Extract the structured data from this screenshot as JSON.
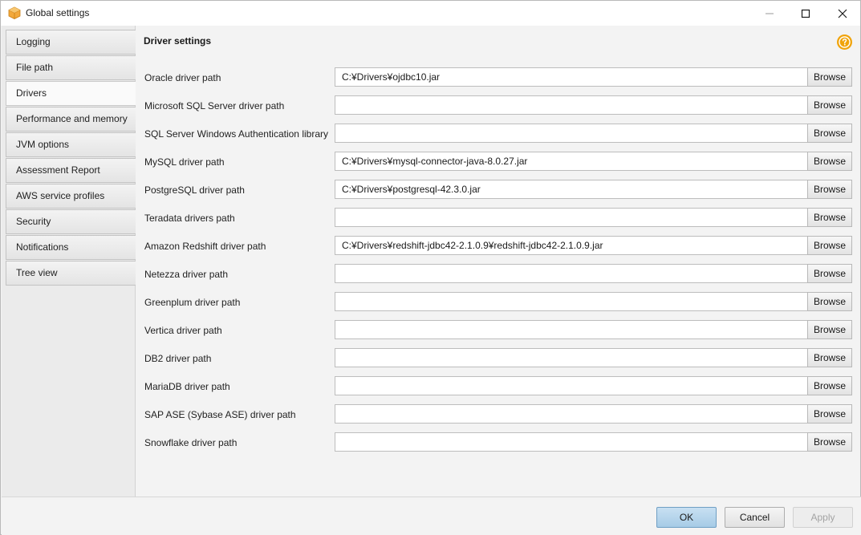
{
  "window": {
    "title": "Global settings"
  },
  "sidebar": {
    "items": [
      {
        "label": "Logging",
        "active": false
      },
      {
        "label": "File path",
        "active": false
      },
      {
        "label": "Drivers",
        "active": true
      },
      {
        "label": "Performance and memory",
        "active": false
      },
      {
        "label": "JVM options",
        "active": false
      },
      {
        "label": "Assessment Report",
        "active": false
      },
      {
        "label": "AWS service profiles",
        "active": false
      },
      {
        "label": "Security",
        "active": false
      },
      {
        "label": "Notifications",
        "active": false
      },
      {
        "label": "Tree view",
        "active": false
      }
    ]
  },
  "main": {
    "title": "Driver settings",
    "browse_label": "Browse",
    "rows": [
      {
        "label": "Oracle driver path",
        "value": "C:¥Drivers¥ojdbc10.jar"
      },
      {
        "label": "Microsoft SQL Server driver path",
        "value": ""
      },
      {
        "label": "SQL Server Windows Authentication library",
        "value": ""
      },
      {
        "label": "MySQL driver path",
        "value": "C:¥Drivers¥mysql-connector-java-8.0.27.jar"
      },
      {
        "label": "PostgreSQL driver path",
        "value": "C:¥Drivers¥postgresql-42.3.0.jar"
      },
      {
        "label": "Teradata drivers path",
        "value": ""
      },
      {
        "label": "Amazon Redshift driver path",
        "value": "C:¥Drivers¥redshift-jdbc42-2.1.0.9¥redshift-jdbc42-2.1.0.9.jar"
      },
      {
        "label": "Netezza driver path",
        "value": ""
      },
      {
        "label": "Greenplum driver path",
        "value": ""
      },
      {
        "label": "Vertica driver path",
        "value": ""
      },
      {
        "label": "DB2 driver path",
        "value": ""
      },
      {
        "label": "MariaDB driver path",
        "value": ""
      },
      {
        "label": "SAP ASE (Sybase ASE) driver path",
        "value": ""
      },
      {
        "label": "Snowflake driver path",
        "value": ""
      }
    ]
  },
  "footer": {
    "ok_label": "OK",
    "cancel_label": "Cancel",
    "apply_label": "Apply"
  },
  "icons": {
    "app": "aws-cube-icon",
    "help": "help-icon",
    "minimize": "minimize-icon",
    "maximize": "maximize-icon",
    "close": "close-icon"
  },
  "colors": {
    "help_accent": "#f0a30a",
    "app_icon": "#f2a83b",
    "ok_button": "#b7d6ee"
  }
}
